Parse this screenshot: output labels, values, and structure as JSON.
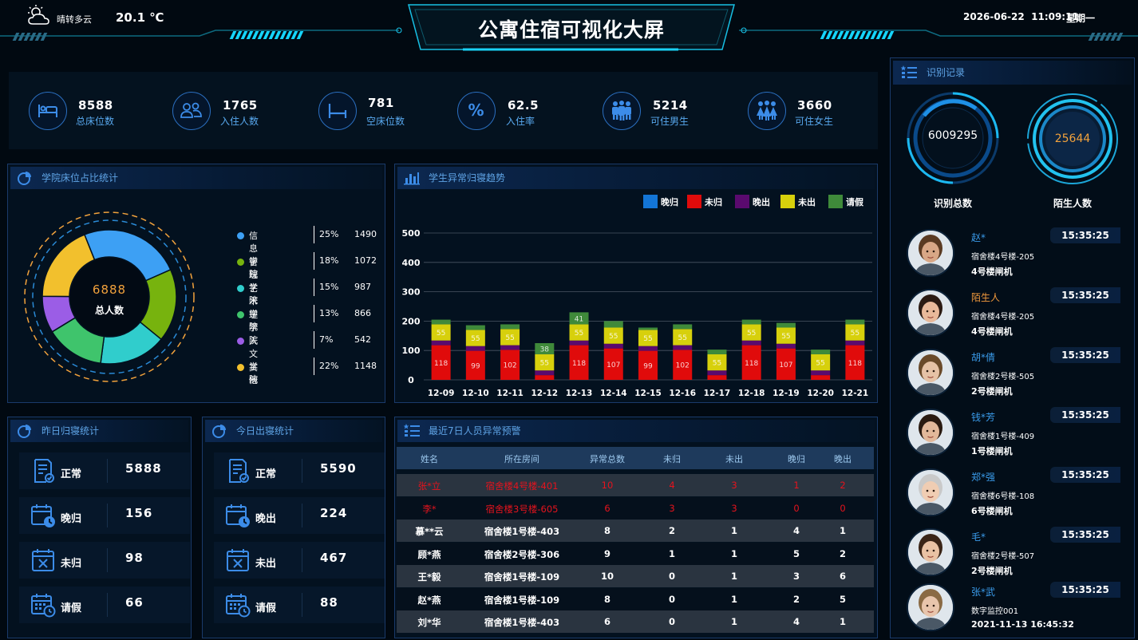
{
  "header": {
    "weather": "晴转多云",
    "temperature": "20.1 ℃",
    "title": "公寓住宿可视化大屏",
    "datetime": "2026-06-22  11:09:11",
    "weekday": "星期一"
  },
  "stats": [
    {
      "icon": "bed-icon",
      "value": "8588",
      "label": "总床位数"
    },
    {
      "icon": "residents-icon",
      "value": "1765",
      "label": "入住人数"
    },
    {
      "icon": "empty-bed-icon",
      "value": "781",
      "label": "空床位数"
    },
    {
      "icon": "percent-icon",
      "value": "62.5",
      "label": "入住率"
    },
    {
      "icon": "male-group-icon",
      "value": "5214",
      "label": "可住男生"
    },
    {
      "icon": "female-group-icon",
      "value": "3660",
      "label": "可住女生"
    }
  ],
  "college_panel": {
    "title": "学院床位占比统计",
    "center_value": "6888",
    "center_label": "总人数",
    "items": [
      {
        "name": "信息学院",
        "pct": "25%",
        "value": "1490",
        "color": "#3da0f4"
      },
      {
        "name": "管理学院",
        "pct": "18%",
        "value": "1072",
        "color": "#77b30e"
      },
      {
        "name": "艺术学院",
        "pct": "15%",
        "value": "987",
        "color": "#30cdcc"
      },
      {
        "name": "理学院",
        "pct": "13%",
        "value": "866",
        "color": "#3fc46c"
      },
      {
        "name": "人文学院",
        "pct": "7%",
        "value": "542",
        "color": "#9b5de6"
      },
      {
        "name": "其他",
        "pct": "22%",
        "value": "1148",
        "color": "#f2c02d"
      }
    ]
  },
  "trend_panel": {
    "title": "学生异常归寝趋势"
  },
  "chart_data": {
    "type": "bar",
    "stacked": true,
    "title": "学生异常归寝趋势",
    "categories": [
      "12-09",
      "12-10",
      "12-11",
      "12-12",
      "12-13",
      "12-14",
      "12-15",
      "12-16",
      "12-17",
      "12-18",
      "12-19",
      "12-20",
      "12-21"
    ],
    "ylim": [
      0,
      500
    ],
    "yticks": [
      0,
      100,
      200,
      300,
      400,
      500
    ],
    "grid": true,
    "legend_position": "top-right",
    "series": [
      {
        "name": "晚归",
        "color": "#1375d6",
        "values": [
          0,
          0,
          0,
          0,
          0,
          0,
          0,
          0,
          0,
          0,
          0,
          0,
          0
        ]
      },
      {
        "name": "未归",
        "color": "#e00b0b",
        "values": [
          118,
          99,
          102,
          16,
          118,
          107,
          99,
          102,
          16,
          118,
          107,
          16,
          118
        ]
      },
      {
        "name": "晚出",
        "color": "#5a0a6e",
        "values": [
          16,
          16,
          16,
          16,
          16,
          16,
          16,
          16,
          16,
          16,
          16,
          16,
          16
        ]
      },
      {
        "name": "未出",
        "color": "#d7d00c",
        "values": [
          55,
          55,
          55,
          55,
          55,
          55,
          55,
          55,
          55,
          55,
          55,
          55,
          55
        ]
      },
      {
        "name": "请假",
        "color": "#3f8a3a",
        "values": [
          16,
          16,
          16,
          38,
          41,
          22,
          8,
          16,
          16,
          16,
          16,
          16,
          16
        ]
      }
    ]
  },
  "yesterday_panel": {
    "title": "昨日归寝统计",
    "items": [
      {
        "icon": "document-check-icon",
        "label": "正常",
        "value": "5888"
      },
      {
        "icon": "calendar-clock-icon",
        "label": "晚归",
        "value": "156"
      },
      {
        "icon": "calendar-x-icon",
        "label": "未归",
        "value": "98"
      },
      {
        "icon": "calendar-leave-icon",
        "label": "请假",
        "value": "66"
      }
    ]
  },
  "today_panel": {
    "title": "今日出寝统计",
    "items": [
      {
        "icon": "document-check-icon",
        "label": "正常",
        "value": "5590"
      },
      {
        "icon": "calendar-clock-icon",
        "label": "晚出",
        "value": "224"
      },
      {
        "icon": "calendar-x-icon",
        "label": "未出",
        "value": "467"
      },
      {
        "icon": "calendar-leave-icon",
        "label": "请假",
        "value": "88"
      }
    ]
  },
  "alert_panel": {
    "title": "最近7日人员异常预警",
    "columns": [
      "姓名",
      "所在房间",
      "异常总数",
      "未归",
      "未出",
      "晚归",
      "晚出"
    ],
    "rows": [
      {
        "cells": [
          "张*立",
          "宿舍楼4号楼-401",
          "10",
          "4",
          "3",
          "1",
          "2"
        ],
        "highlight": true
      },
      {
        "cells": [
          "李*",
          "宿舍楼3号楼-605",
          "6",
          "3",
          "3",
          "0",
          "0"
        ],
        "highlight": true
      },
      {
        "cells": [
          "慕**云",
          "宿舍楼1号楼-403",
          "8",
          "2",
          "1",
          "4",
          "1"
        ],
        "highlight": false
      },
      {
        "cells": [
          "顾*燕",
          "宿舍楼2号楼-306",
          "9",
          "1",
          "1",
          "5",
          "2"
        ],
        "highlight": false
      },
      {
        "cells": [
          "王*毅",
          "宿舍楼1号楼-109",
          "10",
          "0",
          "1",
          "3",
          "6"
        ],
        "highlight": false
      },
      {
        "cells": [
          "赵*燕",
          "宿舍楼1号楼-109",
          "8",
          "0",
          "1",
          "2",
          "5"
        ],
        "highlight": false
      },
      {
        "cells": [
          "刘*华",
          "宿舍楼1号楼-403",
          "6",
          "0",
          "1",
          "4",
          "1"
        ],
        "highlight": false
      }
    ]
  },
  "recognition_panel": {
    "title": "识别记录",
    "total_value": "6009295",
    "total_label": "识别总数",
    "stranger_value": "25644",
    "stranger_label": "陌生人数",
    "records": [
      {
        "name": "赵*",
        "dorm": "宿舍楼4号楼-205",
        "device": "4号楼闸机",
        "time": "15:35:25",
        "stranger": false
      },
      {
        "name": "陌生人",
        "dorm": "宿舍楼4号楼-205",
        "device": "4号楼闸机",
        "time": "15:35:25",
        "stranger": true
      },
      {
        "name": "胡*倩",
        "dorm": "宿舍楼2号楼-505",
        "device": "2号楼闸机",
        "time": "15:35:25",
        "stranger": false
      },
      {
        "name": "钱*芳",
        "dorm": "宿舍楼1号楼-409",
        "device": "1号楼闸机",
        "time": "15:35:25",
        "stranger": false
      },
      {
        "name": "郑*强",
        "dorm": "宿舍楼6号楼-108",
        "device": "6号楼闸机",
        "time": "15:35:25",
        "stranger": false
      },
      {
        "name": "毛*",
        "dorm": "宿舍楼2号楼-507",
        "device": "2号楼闸机",
        "time": "15:35:25",
        "stranger": false
      },
      {
        "name": "张*武",
        "dorm": "数字监控001",
        "device": "2021-11-13 16:45:32",
        "time": "15:35:25",
        "stranger": false
      }
    ]
  }
}
